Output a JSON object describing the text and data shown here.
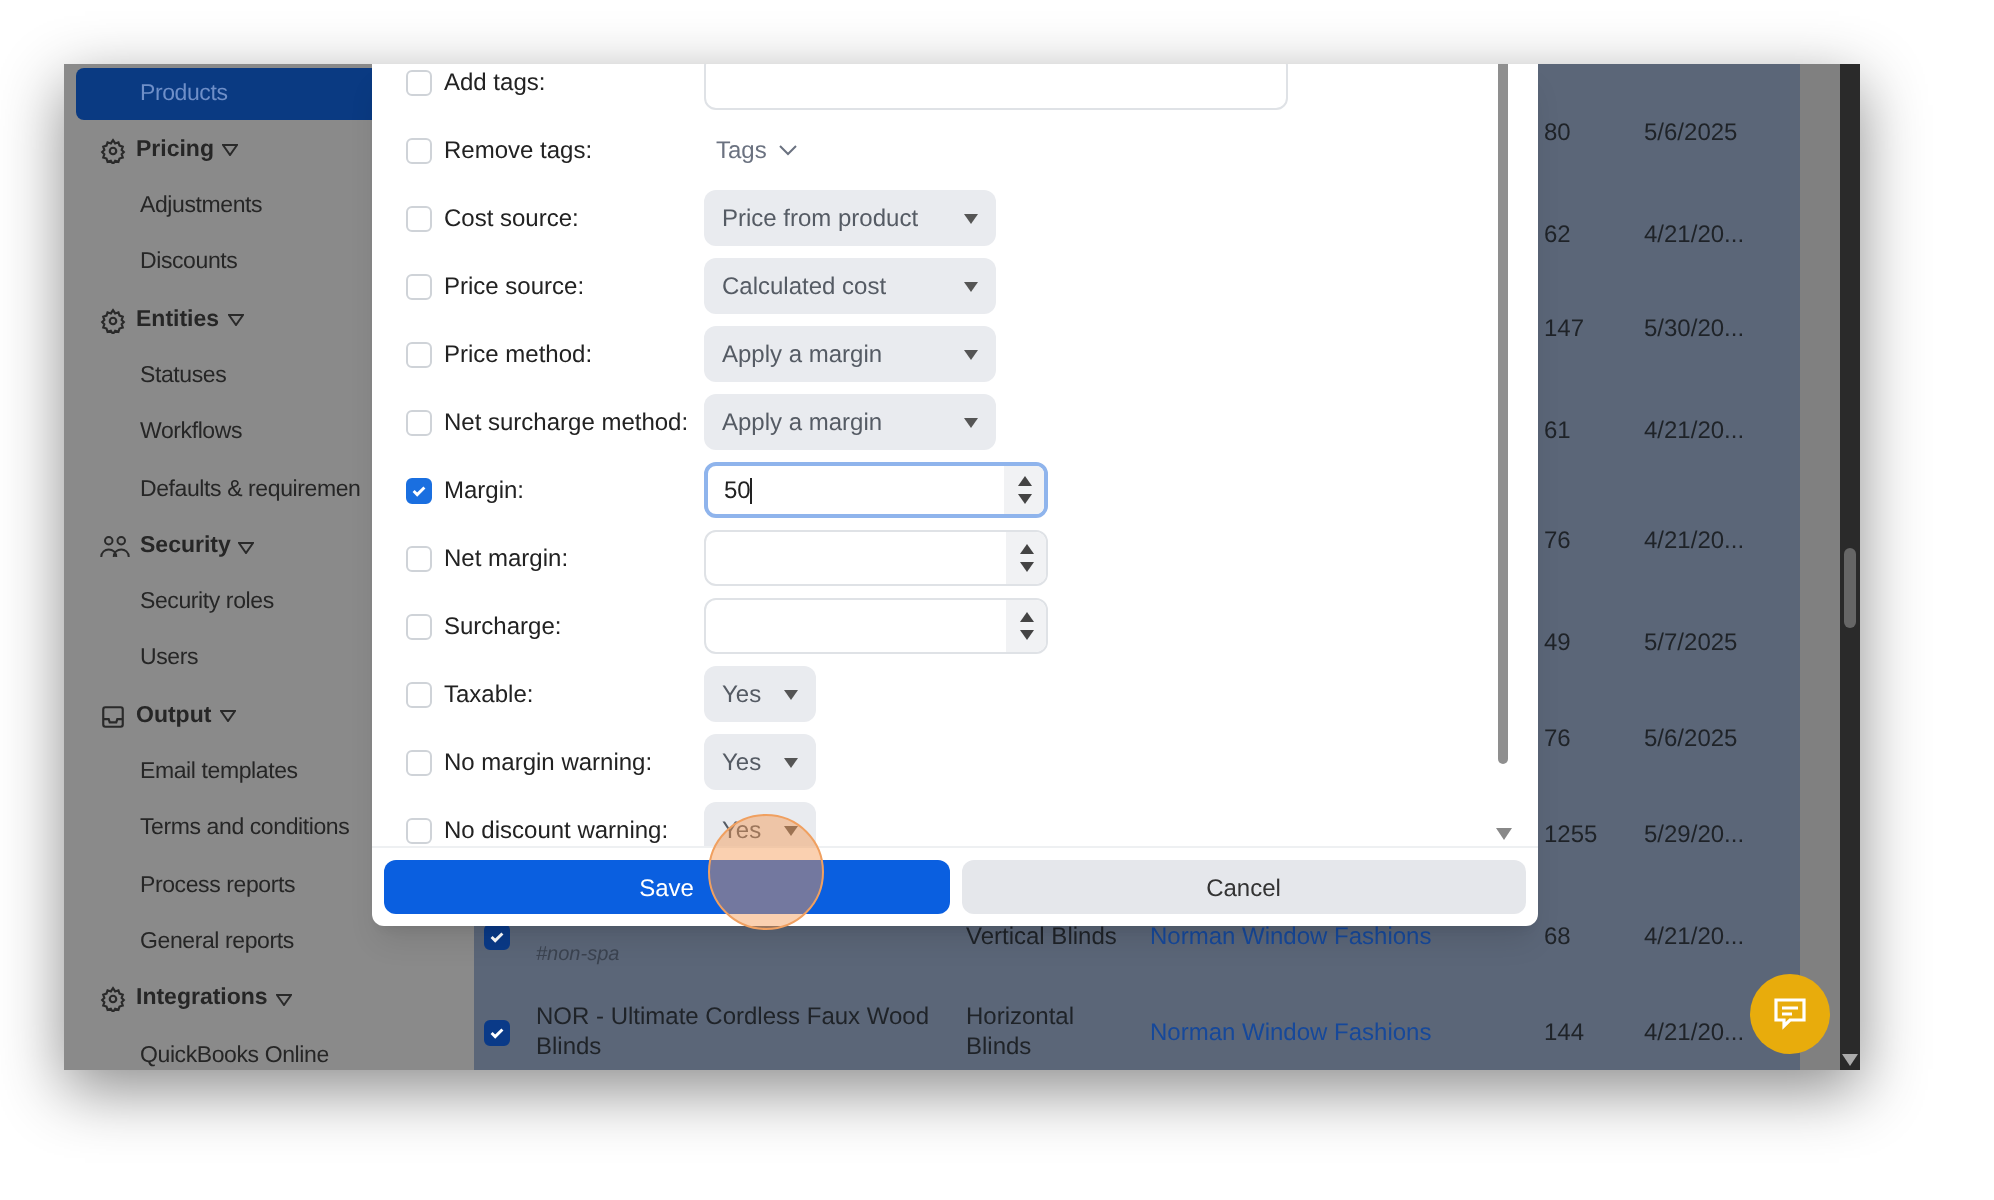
{
  "sidebar": {
    "items": [
      {
        "label": "Products",
        "kind": "item",
        "selected": true
      },
      {
        "label": "Pricing",
        "kind": "section",
        "expanded": true
      },
      {
        "label": "Adjustments",
        "kind": "item",
        "selected": false
      },
      {
        "label": "Discounts",
        "kind": "item",
        "selected": false
      },
      {
        "label": "Entities",
        "kind": "section",
        "expanded": true
      },
      {
        "label": "Statuses",
        "kind": "item",
        "selected": false
      },
      {
        "label": "Workflows",
        "kind": "item",
        "selected": false
      },
      {
        "label": "Defaults & requiremen",
        "kind": "item",
        "selected": false
      },
      {
        "label": "Security",
        "kind": "section",
        "expanded": true
      },
      {
        "label": "Security roles",
        "kind": "item",
        "selected": false
      },
      {
        "label": "Users",
        "kind": "item",
        "selected": false
      },
      {
        "label": "Output",
        "kind": "section",
        "expanded": true
      },
      {
        "label": "Email templates",
        "kind": "item",
        "selected": false
      },
      {
        "label": "Terms and conditions",
        "kind": "item",
        "selected": false
      },
      {
        "label": "Process reports",
        "kind": "item",
        "selected": false
      },
      {
        "label": "General reports",
        "kind": "item",
        "selected": false
      },
      {
        "label": "Integrations",
        "kind": "section",
        "expanded": true
      },
      {
        "label": "QuickBooks Online",
        "kind": "item",
        "selected": false
      }
    ]
  },
  "table": {
    "rows": [
      {
        "column_4": "80",
        "column_5": "5/6/2025"
      },
      {
        "column_4": "62",
        "column_5": "4/21/20..."
      },
      {
        "column_4": "147",
        "column_5": "5/30/20..."
      },
      {
        "column_4": "61",
        "column_5": "4/21/20..."
      },
      {
        "column_4": "76",
        "column_5": "4/21/20..."
      },
      {
        "column_4": "49",
        "column_5": "5/7/2025"
      },
      {
        "column_4": "76",
        "column_5": "5/6/2025"
      },
      {
        "column_4": "1255",
        "column_5": "5/29/20..."
      },
      {
        "checked": true,
        "column_1_note": "#non-spa",
        "column_2": "Vertical Blinds",
        "column_3": "Norman Window Fashions",
        "column_4": "68",
        "column_5": "4/21/20..."
      },
      {
        "checked": true,
        "column_1": "NOR - Ultimate Cordless Faux Wood Blinds",
        "column_2": "Horizontal Blinds",
        "column_3": "Norman Window Fashions",
        "column_4": "144",
        "column_5": "4/21/20..."
      }
    ]
  },
  "modal": {
    "fields": [
      {
        "label": "Add tags:",
        "checked": false,
        "kind": "text"
      },
      {
        "label": "Remove tags:",
        "checked": false,
        "kind": "tags",
        "value": "Tags"
      },
      {
        "label": "Cost source:",
        "checked": false,
        "kind": "select",
        "value": "Price from product"
      },
      {
        "label": "Price source:",
        "checked": false,
        "kind": "select",
        "value": "Calculated cost"
      },
      {
        "label": "Price method:",
        "checked": false,
        "kind": "select",
        "value": "Apply a margin"
      },
      {
        "label": "Net surcharge method:",
        "checked": false,
        "kind": "select",
        "value": "Apply a margin"
      },
      {
        "label": "Margin:",
        "checked": true,
        "kind": "number",
        "value": "50",
        "focused": true
      },
      {
        "label": "Net margin:",
        "checked": false,
        "kind": "number",
        "focused": false
      },
      {
        "label": "Surcharge:",
        "checked": false,
        "kind": "number",
        "focused": false
      },
      {
        "label": "Taxable:",
        "checked": false,
        "kind": "toggle",
        "value": "Yes"
      },
      {
        "label": "No margin warning:",
        "checked": false,
        "kind": "toggle",
        "value": "Yes"
      },
      {
        "label": "No discount warning:",
        "checked": false,
        "kind": "toggle",
        "value": "Yes"
      }
    ],
    "buttons": [
      {
        "label": "Save",
        "kind": "primary"
      },
      {
        "label": "Cancel",
        "kind": "secondary"
      }
    ]
  }
}
